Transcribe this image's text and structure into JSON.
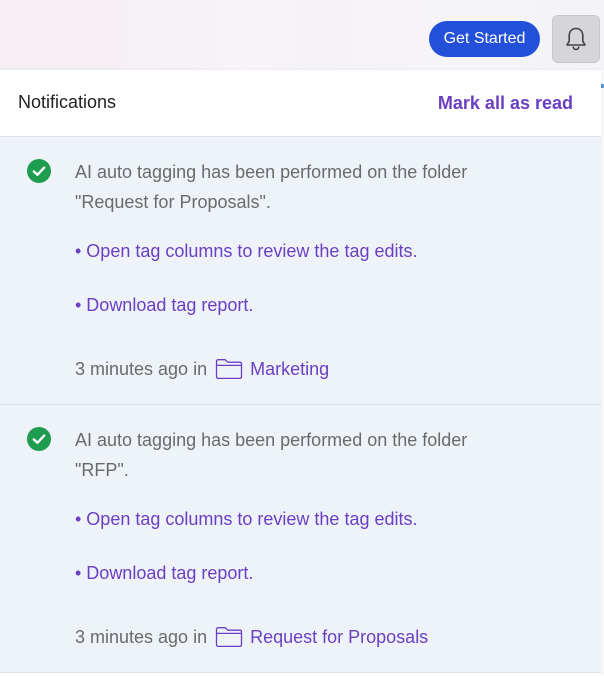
{
  "topbar": {
    "get_started_label": "Get Started",
    "bell_icon": "bell-icon"
  },
  "panel": {
    "title": "Notifications",
    "mark_all_label": "Mark all as read"
  },
  "notifications": [
    {
      "status_icon": "check-circle-icon",
      "message_line1": "AI auto tagging has been performed on the folder",
      "message_line2": "\"Request for Proposals\".",
      "link1": "• Open tag columns to review the tag edits.",
      "link2": "• Download tag report.",
      "time": "3 minutes ago in",
      "folder_icon": "folder-icon",
      "folder": "Marketing"
    },
    {
      "status_icon": "check-circle-icon",
      "message_line1": "AI auto tagging has been performed on the folder",
      "message_line2": "\"RFP\".",
      "link1": "• Open tag columns to review the tag edits.",
      "link2": "• Download tag report.",
      "time": "3 minutes ago in",
      "folder_icon": "folder-icon",
      "folder": "Request for Proposals"
    }
  ],
  "colors": {
    "primary_button": "#2250d9",
    "link": "#6b3fc2",
    "success": "#1e9c4f",
    "notification_bg": "#eef3fa"
  }
}
